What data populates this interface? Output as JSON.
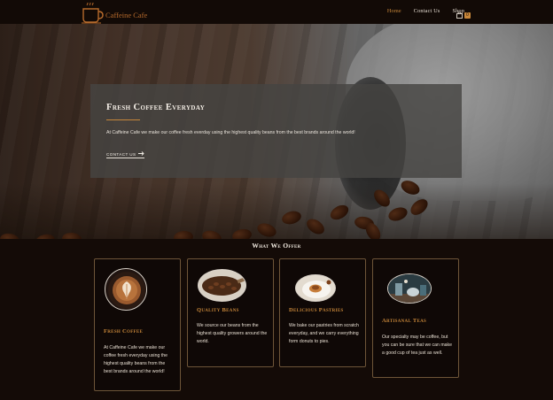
{
  "brand": {
    "name": "Caffeine Cafe"
  },
  "nav": {
    "links": [
      {
        "label": "Home",
        "active": true
      },
      {
        "label": "Contact Us",
        "active": false
      },
      {
        "label": "Shop",
        "active": false
      }
    ],
    "cart_count": "0"
  },
  "hero": {
    "title": "Fresh Coffee Everyday",
    "text": "At Caffeine Cafe we make our coffee fresh everday using the highest quality beans from the best brands around the world!",
    "button_label": "CONTACT US"
  },
  "offer": {
    "title": "What We Offer",
    "cards": [
      {
        "title": "Fresh Coffee",
        "text": "At Caffeine Cafe we make our coffee fresh everyday using the highest quality beans from the best brands around the world!"
      },
      {
        "title": "Quality Beans",
        "text": "We source our beans from the highest quality growers around the world."
      },
      {
        "title": "Delicious Pastries",
        "text": "We bake our pastries from scratch everyday, and we carry everything form donuts to pies."
      },
      {
        "title": "Artisanal Teas",
        "text": "Our specialty may be coffee, but you can be sure that we can make a good cup of tea just as well."
      }
    ]
  },
  "colors": {
    "accent": "#c8873a",
    "background": "#140b07",
    "card_border": "#6e5538"
  }
}
